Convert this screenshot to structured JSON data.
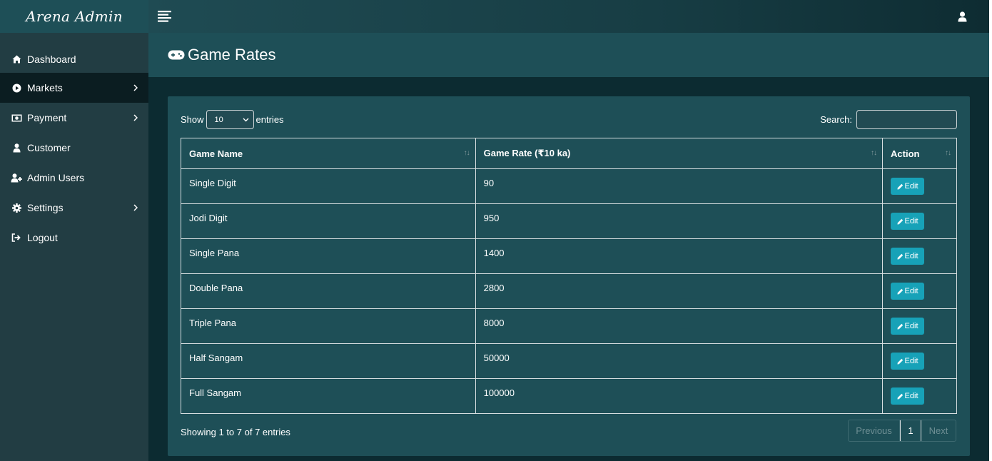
{
  "brand": "Arena Admin",
  "sidebar": {
    "items": [
      {
        "label": "Dashboard",
        "icon": "home-icon"
      },
      {
        "label": "Markets",
        "icon": "play-circle-icon"
      },
      {
        "label": "Payment",
        "icon": "money-icon"
      },
      {
        "label": "Customer",
        "icon": "user-icon"
      },
      {
        "label": "Admin Users",
        "icon": "user-plus-icon"
      },
      {
        "label": "Settings",
        "icon": "gear-icon"
      },
      {
        "label": "Logout",
        "icon": "sign-out-icon"
      }
    ]
  },
  "page": {
    "title": "Game Rates"
  },
  "controls": {
    "show_label": "Show",
    "entries_label": "entries",
    "length_value": "10",
    "search_label": "Search:",
    "search_value": ""
  },
  "table": {
    "headers": [
      "Game Name",
      "Game Rate (₹10 ka)",
      "Action"
    ],
    "rows": [
      {
        "name": "Single Digit",
        "rate": "90",
        "action": "Edit"
      },
      {
        "name": "Jodi Digit",
        "rate": "950",
        "action": "Edit"
      },
      {
        "name": "Single Pana",
        "rate": "1400",
        "action": "Edit"
      },
      {
        "name": "Double Pana",
        "rate": "2800",
        "action": "Edit"
      },
      {
        "name": "Triple Pana",
        "rate": "8000",
        "action": "Edit"
      },
      {
        "name": "Half Sangam",
        "rate": "50000",
        "action": "Edit"
      },
      {
        "name": "Full Sangam",
        "rate": "100000",
        "action": "Edit"
      }
    ]
  },
  "footer": {
    "info": "Showing 1 to 7 of 7 entries",
    "prev": "Previous",
    "page": "1",
    "next": "Next"
  },
  "colors": {
    "sidebar_bg": "#223d43",
    "header_bg": "#1e4f57",
    "content_bg": "#0c2b31",
    "active_item_bg": "#0b1d21",
    "edit_button": "#17a2b8"
  }
}
